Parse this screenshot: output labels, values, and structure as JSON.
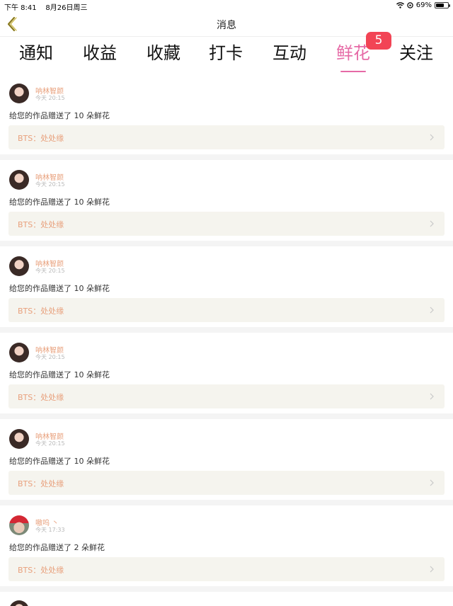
{
  "status_bar": {
    "time": "下午 8:41",
    "date": "8月26日周三",
    "battery": "69%",
    "battery_level": 0.69
  },
  "nav": {
    "title": "消息"
  },
  "tabs": [
    {
      "label": "通知",
      "active": false
    },
    {
      "label": "收益",
      "active": false
    },
    {
      "label": "收藏",
      "active": false
    },
    {
      "label": "打卡",
      "active": false
    },
    {
      "label": "互动",
      "active": false
    },
    {
      "label": "鲜花",
      "active": true
    },
    {
      "label": "关注",
      "active": false
    }
  ],
  "badge": {
    "count": "5"
  },
  "colors": {
    "accent": "#e66aa6",
    "badge": "#f24455",
    "name": "#e8a07c",
    "row_bg": "#f5f4ee"
  },
  "items": [
    {
      "name": "呐林智颜",
      "time": "今天 20:15",
      "message": "给您的作品赠送了 10 朵鲜花",
      "work": "BTS：处处缘",
      "avatar": "girl"
    },
    {
      "name": "呐林智颜",
      "time": "今天 20:15",
      "message": "给您的作品赠送了 10 朵鲜花",
      "work": "BTS：处处缘",
      "avatar": "girl"
    },
    {
      "name": "呐林智颜",
      "time": "今天 20:15",
      "message": "给您的作品赠送了 10 朵鲜花",
      "work": "BTS：处处缘",
      "avatar": "girl"
    },
    {
      "name": "呐林智颜",
      "time": "今天 20:15",
      "message": "给您的作品赠送了 10 朵鲜花",
      "work": "BTS：处处缘",
      "avatar": "girl"
    },
    {
      "name": "呐林智颜",
      "time": "今天 20:15",
      "message": "给您的作品赠送了 10 朵鲜花",
      "work": "BTS：处处缘",
      "avatar": "girl"
    },
    {
      "name": "嗷呜 丶",
      "time": "今天 17:33",
      "message": "给您的作品赠送了 2 朵鲜花",
      "work": "BTS：处处缘",
      "avatar": "boy"
    }
  ]
}
